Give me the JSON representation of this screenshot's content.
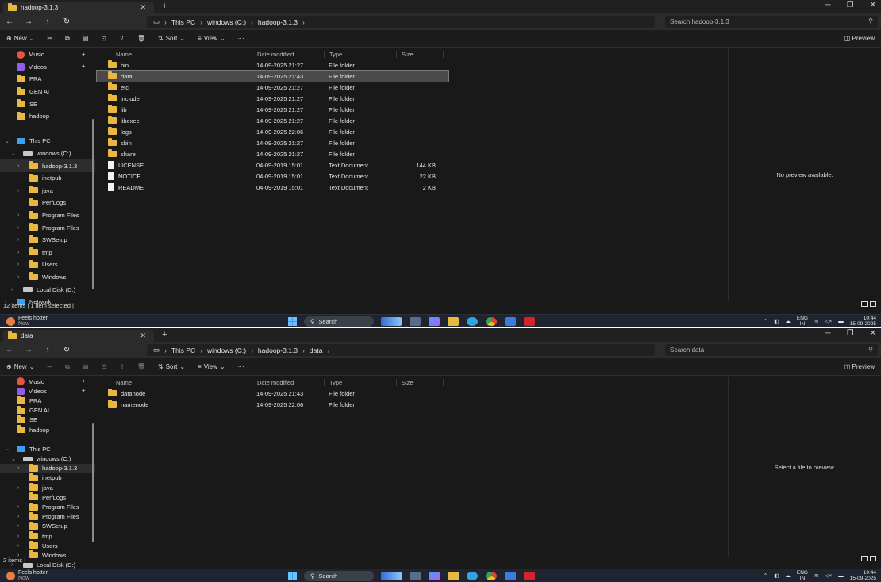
{
  "windows": [
    {
      "tab_title": "hadoop-3.1.3",
      "breadcrumbs": [
        "This PC",
        "windows (C:)",
        "hadoop-3.1.3"
      ],
      "search_placeholder": "Search hadoop-3.1.3",
      "toolbar": {
        "new": "New",
        "sort": "Sort",
        "view": "View",
        "more": "···",
        "preview": "Preview"
      },
      "columns": {
        "name": "Name",
        "date": "Date modified",
        "type": "Type",
        "size": "Size"
      },
      "files": [
        {
          "icon": "folder-icon",
          "name": "bin",
          "date": "14-09-2025 21:27",
          "type": "File folder",
          "size": ""
        },
        {
          "icon": "folder-icon",
          "name": "data",
          "date": "14-09-2025 21:43",
          "type": "File folder",
          "size": "",
          "selected": true
        },
        {
          "icon": "folder-icon",
          "name": "etc",
          "date": "14-09-2025 21:27",
          "type": "File folder",
          "size": ""
        },
        {
          "icon": "folder-icon",
          "name": "include",
          "date": "14-09-2025 21:27",
          "type": "File folder",
          "size": ""
        },
        {
          "icon": "folder-icon",
          "name": "lib",
          "date": "14-09-2025 21:27",
          "type": "File folder",
          "size": ""
        },
        {
          "icon": "folder-icon",
          "name": "libexec",
          "date": "14-09-2025 21:27",
          "type": "File folder",
          "size": ""
        },
        {
          "icon": "folder-icon",
          "name": "logs",
          "date": "14-09-2025 22:06",
          "type": "File folder",
          "size": ""
        },
        {
          "icon": "folder-icon",
          "name": "sbin",
          "date": "14-09-2025 21:27",
          "type": "File folder",
          "size": ""
        },
        {
          "icon": "folder-icon",
          "name": "share",
          "date": "14-09-2025 21:27",
          "type": "File folder",
          "size": ""
        },
        {
          "icon": "document-icon",
          "name": "LICENSE",
          "date": "04-09-2019 15:01",
          "type": "Text Document",
          "size": "144 KB"
        },
        {
          "icon": "document-icon",
          "name": "NOTICE",
          "date": "04-09-2019 15:01",
          "type": "Text Document",
          "size": "22 KB"
        },
        {
          "icon": "document-icon",
          "name": "README",
          "date": "04-09-2019 15:01",
          "type": "Text Document",
          "size": "2 KB"
        }
      ],
      "preview_text": "No preview available.",
      "status": "12 items  |  1 item selected  |"
    },
    {
      "tab_title": "data",
      "breadcrumbs": [
        "This PC",
        "windows (C:)",
        "hadoop-3.1.3",
        "data"
      ],
      "search_placeholder": "Search data",
      "toolbar": {
        "new": "New",
        "sort": "Sort",
        "view": "View",
        "more": "···",
        "preview": "Preview"
      },
      "columns": {
        "name": "Name",
        "date": "Date modified",
        "type": "Type",
        "size": "Size"
      },
      "files": [
        {
          "icon": "folder-icon",
          "name": "datanode",
          "date": "14-09-2025 21:43",
          "type": "File folder",
          "size": ""
        },
        {
          "icon": "folder-icon",
          "name": "namenode",
          "date": "14-09-2025 22:06",
          "type": "File folder",
          "size": ""
        }
      ],
      "preview_text": "Select a file to preview.",
      "status": "2 items  |"
    }
  ],
  "sidebar": [
    {
      "label": "Music",
      "icon": "music-icon",
      "pinned": true
    },
    {
      "label": "Videos",
      "icon": "videos-icon",
      "pinned": true
    },
    {
      "label": "PRA",
      "icon": "folder-icon"
    },
    {
      "label": "GEN AI",
      "icon": "folder-icon"
    },
    {
      "label": "SE",
      "icon": "folder-icon"
    },
    {
      "label": "hadoop",
      "icon": "folder-icon"
    },
    {
      "label": "",
      "icon": "none"
    },
    {
      "label": "This PC",
      "icon": "pc-icon",
      "expanded": true
    },
    {
      "label": "windows (C:)",
      "icon": "drive-icon",
      "expanded": true,
      "indent": 1
    },
    {
      "label": "hadoop-3.1.3",
      "icon": "folder-icon",
      "indent": 2,
      "chevron": true,
      "selected": true
    },
    {
      "label": "inetpub",
      "icon": "folder-icon",
      "indent": 2
    },
    {
      "label": "java",
      "icon": "folder-icon",
      "indent": 2,
      "chevron": true
    },
    {
      "label": "PerfLogs",
      "icon": "folder-icon",
      "indent": 2
    },
    {
      "label": "Program Files",
      "icon": "folder-icon",
      "indent": 2,
      "chevron": true
    },
    {
      "label": "Program Files",
      "icon": "folder-icon",
      "indent": 2,
      "chevron": true
    },
    {
      "label": "SWSetup",
      "icon": "folder-icon",
      "indent": 2,
      "chevron": true
    },
    {
      "label": "tmp",
      "icon": "folder-icon",
      "indent": 2,
      "chevron": true
    },
    {
      "label": "Users",
      "icon": "folder-icon",
      "indent": 2,
      "chevron": true
    },
    {
      "label": "Windows",
      "icon": "folder-icon",
      "indent": 2,
      "chevron": true
    },
    {
      "label": "Local Disk (D:)",
      "icon": "drive-icon",
      "indent": 1,
      "chevron": true
    },
    {
      "label": "Network",
      "icon": "network-icon",
      "chevron": true
    }
  ],
  "taskbar": {
    "weather_title": "Feels hotter",
    "weather_sub": "Now",
    "search_label": "Search",
    "lang_top": "ENG",
    "lang_bottom": "IN",
    "time": "10:44",
    "date": "15-09-2025"
  }
}
